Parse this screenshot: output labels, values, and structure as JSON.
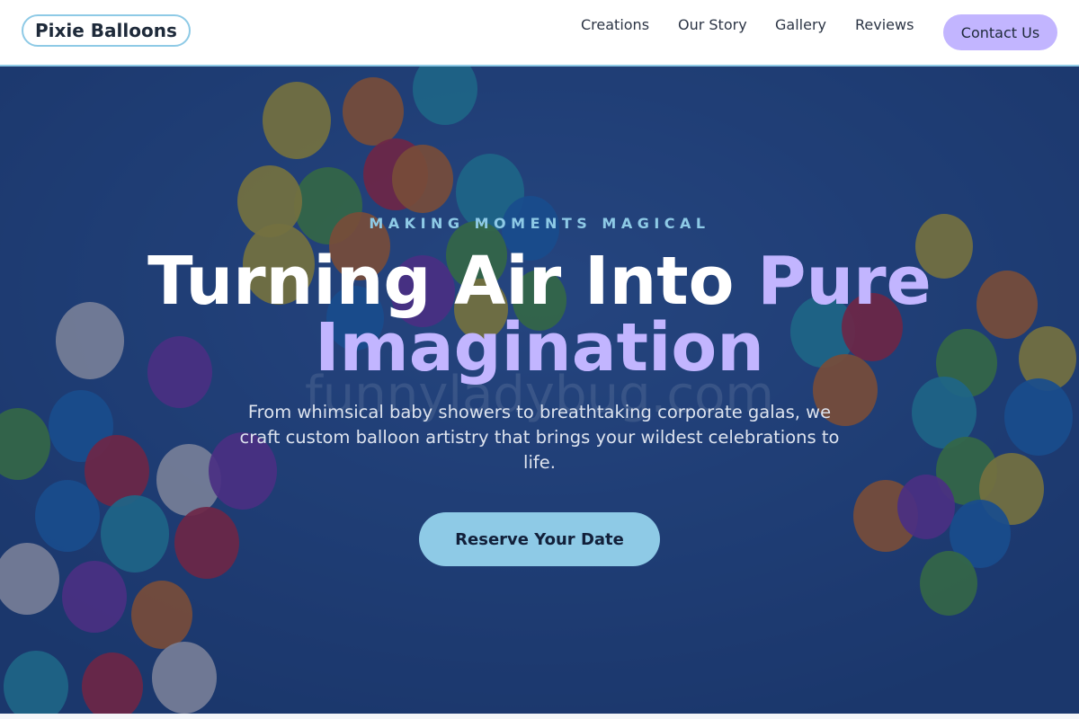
{
  "header": {
    "logo_text": "Pixie Balloons",
    "nav": [
      {
        "label": "Creations"
      },
      {
        "label": "Our Story"
      },
      {
        "label": "Gallery"
      },
      {
        "label": "Reviews"
      }
    ],
    "contact_label": "Contact Us"
  },
  "hero": {
    "eyebrow": "MAKING MOMENTS MAGICAL",
    "headline_main": "Turning Air Into ",
    "headline_accent": "Pure Imagination",
    "tagline": "From whimsical baby showers to breathtaking corporate galas, we craft custom balloon artistry that brings your wildest celebrations to life.",
    "cta_label": "Reserve Your Date",
    "watermark": "funnyladybug.com",
    "background_image": "balloon-cluster-sky-photo"
  },
  "colors": {
    "accent_lavender": "#c2b5ff",
    "accent_sky": "#8ecae6",
    "hero_overlay": "#1b2c5c",
    "heading_white": "#ffffff"
  }
}
